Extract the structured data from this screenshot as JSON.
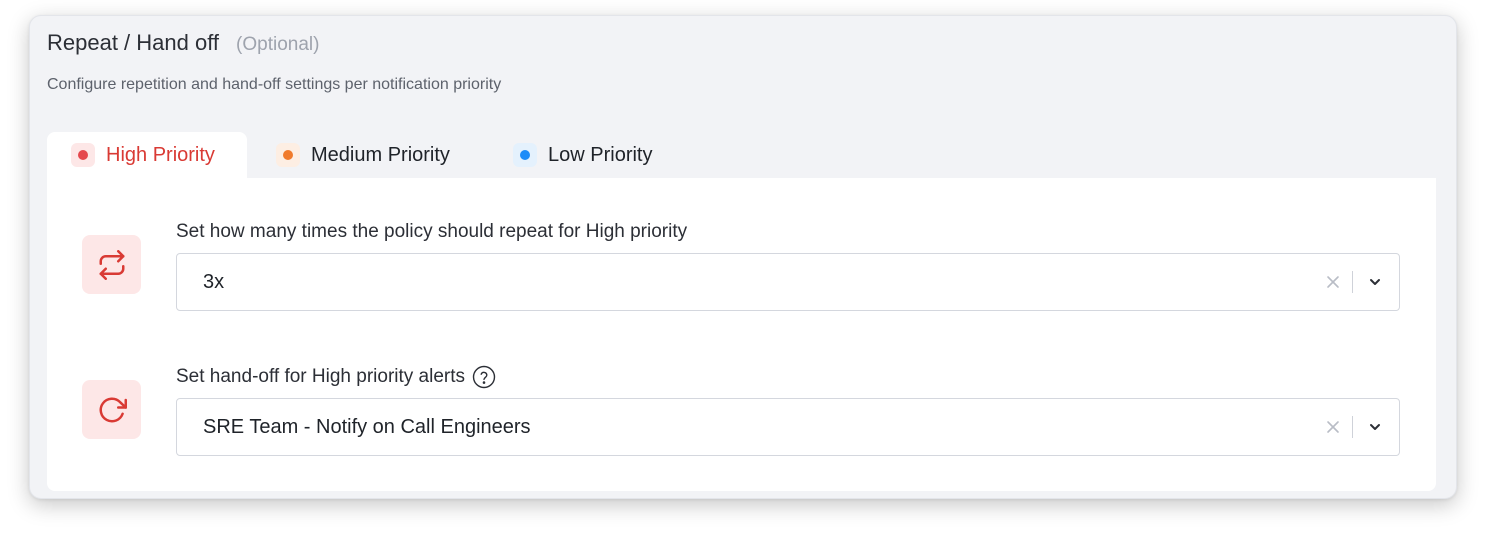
{
  "section": {
    "title": "Repeat / Hand off",
    "optional_label": "(Optional)",
    "subtitle": "Configure repetition and hand-off settings per notification priority"
  },
  "tabs": [
    {
      "label": "High Priority",
      "active": true,
      "dot_color": "#e5484d",
      "dot_bg": "#fde7e7",
      "text_color": "#d93a34"
    },
    {
      "label": "Medium Priority",
      "active": false,
      "dot_color": "#f07a2b",
      "dot_bg": "#fdeee3"
    },
    {
      "label": "Low Priority",
      "active": false,
      "dot_color": "#1d8cf8",
      "dot_bg": "#e4f1fd"
    }
  ],
  "repeat": {
    "icon": "repeat-icon",
    "label": "Set how many times the policy should repeat for High priority",
    "value": "3x"
  },
  "handoff": {
    "icon": "rotate-cw-icon",
    "label": "Set hand-off for High priority alerts",
    "help_icon": "question-circle-icon",
    "value": "SRE Team - Notify on Call Engineers"
  },
  "colors": {
    "accent_red": "#d93a34",
    "icon_tile_bg": "#fde7e7",
    "card_bg": "#f2f3f6"
  }
}
